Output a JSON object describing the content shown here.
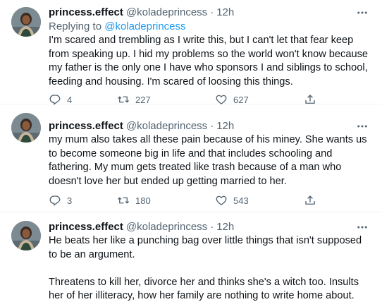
{
  "tweets": [
    {
      "name": "princess.effect",
      "handle": "@koladeprincess",
      "separator": "·",
      "time": "12h",
      "reply_prefix": "Replying to",
      "reply_to": "@koladeprincess",
      "paragraphs": [
        "I'm scared and trembling as I write this, but I can't let that fear keep from speaking up. I hid my problems so the world won't know because my father is the only one I have who sponsors I and siblings to school, feeding and housing. I'm scared of loosing this things."
      ],
      "replies": "4",
      "retweets": "227",
      "likes": "627"
    },
    {
      "name": "princess.effect",
      "handle": "@koladeprincess",
      "separator": "·",
      "time": "12h",
      "paragraphs": [
        "my mum also takes all these pain because of his miney. She wants us to become someone big in life and that includes schooling and fathering. My mum gets treated like trash because of a man who doesn't love her but ended up getting married to her."
      ],
      "replies": "3",
      "retweets": "180",
      "likes": "543"
    },
    {
      "name": "princess.effect",
      "handle": "@koladeprincess",
      "separator": "·",
      "time": "12h",
      "paragraphs": [
        "He beats her like a punching bag over little things that isn't supposed to be an argument.",
        "Threatens to kill her, divorce her and thinks she's a witch too. Insults her of her illiteracy, how her family are nothing to write home about."
      ]
    }
  ],
  "icons": {
    "more": "more-horizontal-icon",
    "reply": "reply-bubble-icon",
    "retweet": "retweet-icon",
    "like": "heart-icon",
    "share": "share-upload-icon"
  },
  "colors": {
    "text": "#0f1419",
    "secondary": "#536471",
    "link": "#1d9bf0",
    "divider": "#eff3f4"
  }
}
